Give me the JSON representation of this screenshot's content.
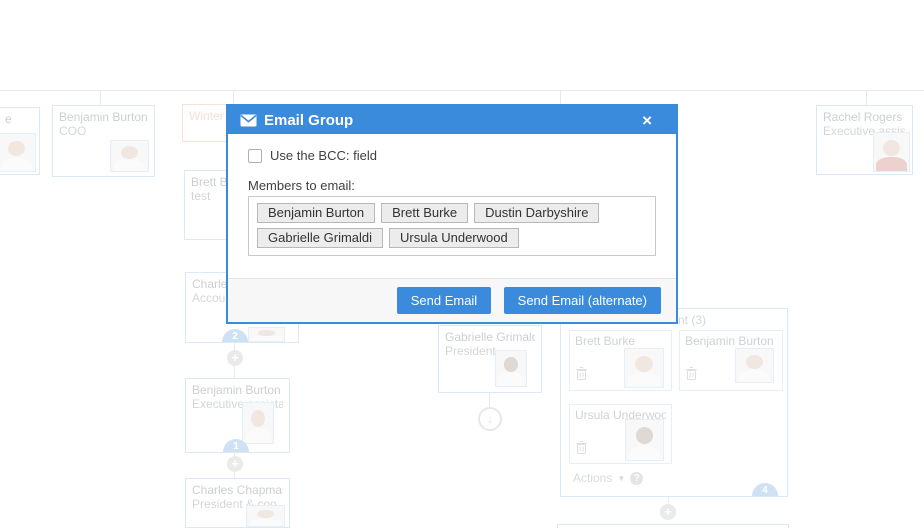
{
  "colors": {
    "primary": "#3a8bdb",
    "card_border": "#7aaee2",
    "orange_border": "#de9468"
  },
  "modal": {
    "title": "Email Group",
    "close": "×",
    "bcc_label": "Use the BCC: field",
    "members_label": "Members to email:",
    "members": [
      "Benjamin Burton",
      "Brett Burke",
      "Dustin Darbyshire",
      "Gabrielle Grimaldi",
      "Ursula Underwood"
    ],
    "send_button": "Send Email",
    "send_alt_button": "Send Email (alternate)"
  },
  "org_chart": {
    "cards": [
      {
        "name": "e",
        "title": ""
      },
      {
        "name": "Benjamin Burton",
        "title": "COO"
      },
      {
        "name": "Winter",
        "title": ""
      },
      {
        "name": "Brett B",
        "title": "test"
      },
      {
        "name": "Charle",
        "title": "Accoun",
        "badge": "2"
      },
      {
        "name": "Benjamin Burton",
        "title": "Executive assistant",
        "badge": "1"
      },
      {
        "name": "Charles Chapman",
        "title": "President & coo"
      },
      {
        "name": "Gabrielle Grimald",
        "title": "President"
      },
      {
        "name": "Rachel Rogers",
        "title": "Executive assistant"
      }
    ],
    "panel": {
      "title_fragment": "nt (3)",
      "members": [
        {
          "name": "Brett Burke"
        },
        {
          "name": "Benjamin Burton"
        },
        {
          "name": "Ursula Underwood"
        }
      ],
      "actions_label": "Actions",
      "badge": "4"
    }
  }
}
